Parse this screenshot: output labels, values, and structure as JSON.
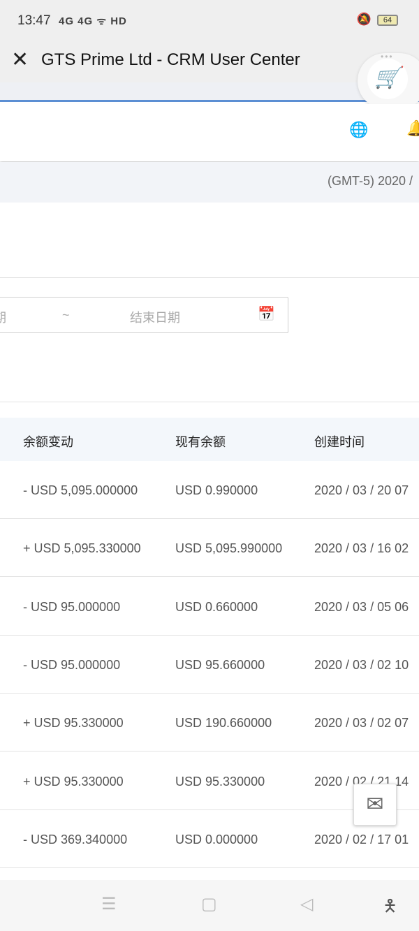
{
  "status": {
    "time": "13:47",
    "signal": "4G 4G ᯤ HD",
    "battery": "64",
    "mute_icon": "bell-off-icon"
  },
  "titlebar": {
    "title": "GTS Prime Ltd - CRM User Center"
  },
  "timezone": "(GMT-5) 2020 /",
  "date_range": {
    "start_partial": "期",
    "separator": "~",
    "end_placeholder": "结束日期"
  },
  "table": {
    "headers": [
      "余额变动",
      "现有余额",
      "创建时间"
    ],
    "rows": [
      [
        "- USD 5,095.000000",
        "USD 0.990000",
        "2020 / 03 / 20 07"
      ],
      [
        "+ USD 5,095.330000",
        "USD 5,095.990000",
        "2020 / 03 / 16 02"
      ],
      [
        "- USD 95.000000",
        "USD 0.660000",
        "2020 / 03 / 05 06"
      ],
      [
        "- USD 95.000000",
        "USD 95.660000",
        "2020 / 03 / 02 10"
      ],
      [
        "+ USD 95.330000",
        "USD 190.660000",
        "2020 / 03 / 02 07"
      ],
      [
        "+ USD 95.330000",
        "USD 95.330000",
        "2020 / 02 / 21 14"
      ],
      [
        "- USD 369.340000",
        "USD 0.000000",
        "2020 / 02 / 17 01"
      ]
    ]
  }
}
